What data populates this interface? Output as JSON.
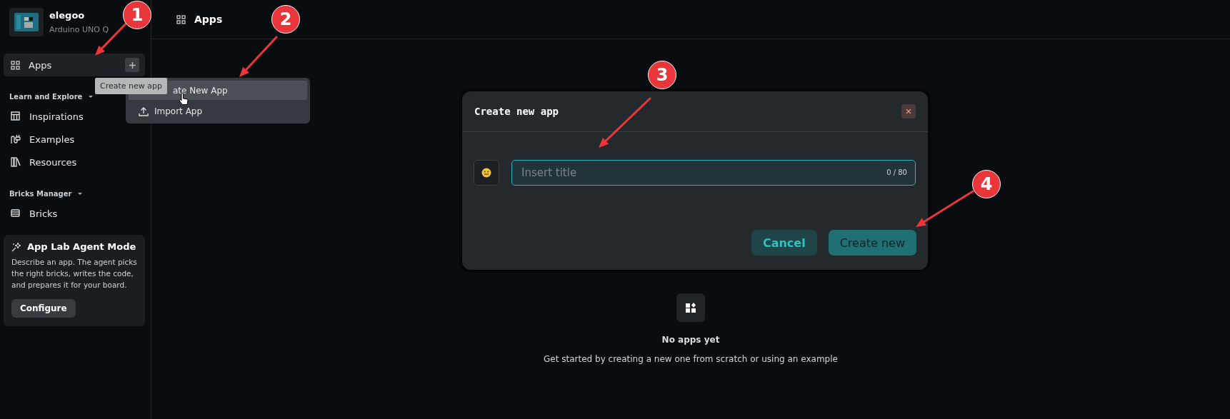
{
  "sidebar": {
    "device": {
      "name": "elegoo",
      "model": "Arduino UNO Q"
    },
    "apps_item": {
      "label": "Apps",
      "selected": true
    },
    "sections": [
      {
        "title": "Learn and Explore",
        "expanded": true,
        "items": [
          {
            "label": "Inspirations"
          },
          {
            "label": "Examples"
          },
          {
            "label": "Resources"
          }
        ]
      },
      {
        "title": "Bricks Manager",
        "expanded": true,
        "items": [
          {
            "label": "Bricks"
          }
        ]
      }
    ],
    "agent_card": {
      "title": "App Lab Agent Mode",
      "description": "Describe an app. The agent picks the right bricks, writes the code, and prepares it for your board.",
      "button": "Configure"
    }
  },
  "tooltip": "Create new app",
  "menu": [
    {
      "label": "ate New App",
      "selected": true
    },
    {
      "label": "Import App",
      "selected": false
    }
  ],
  "header": {
    "title": "Apps"
  },
  "empty_state": {
    "title": "No apps yet",
    "description": "Get started by creating a new one from scratch or using an example"
  },
  "dialog": {
    "title": "Create new app",
    "field": {
      "placeholder": "Insert title",
      "counter": "0 / 80"
    },
    "buttons": [
      {
        "label": "Cancel",
        "kind": "secondary"
      },
      {
        "label": "Create new",
        "kind": "primary"
      }
    ]
  },
  "annotations": [
    {
      "number": "1"
    },
    {
      "number": "2"
    },
    {
      "number": "3"
    },
    {
      "number": "4"
    }
  ]
}
